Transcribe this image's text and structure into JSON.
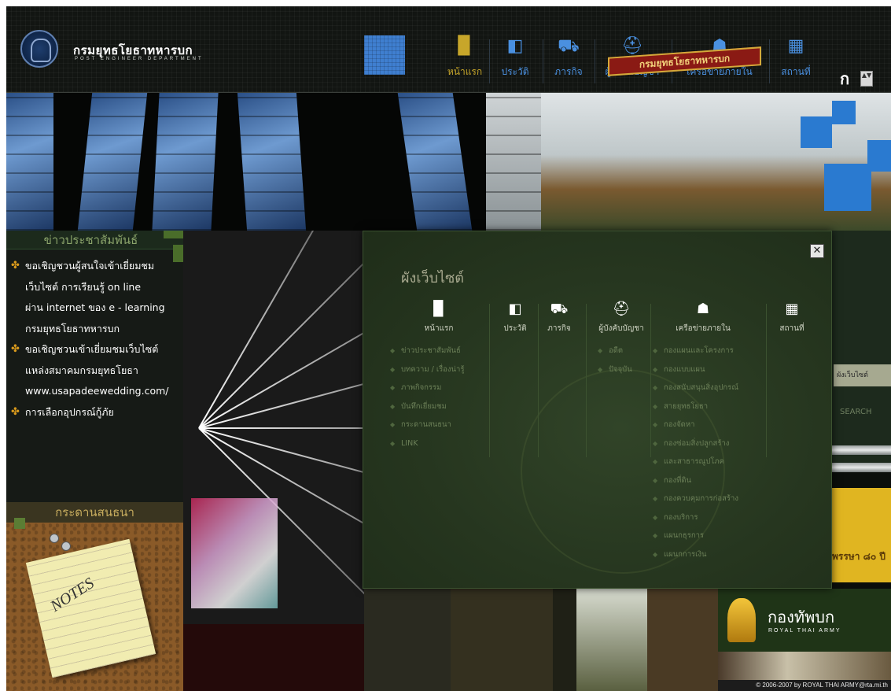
{
  "header": {
    "org_name": "กรมยุทธโยธาทหารบก",
    "org_sub": "POST ENGINEER DEPARTMENT",
    "nav": [
      {
        "label": "หน้าแรก",
        "icon": "book-icon",
        "glyph": "▉"
      },
      {
        "label": "ประวัติ",
        "icon": "open-book-icon",
        "glyph": "◧"
      },
      {
        "label": "ภารกิจ",
        "icon": "vehicle-icon",
        "glyph": "⛟"
      },
      {
        "label": "ผู้บังคับบัญชา",
        "icon": "cap-icon",
        "glyph": "⛑"
      },
      {
        "label": "เครือข่ายภายใน",
        "icon": "network-icon",
        "glyph": "☗"
      },
      {
        "label": "สถานที่",
        "icon": "building-icon",
        "glyph": "▦"
      }
    ],
    "font_size_letter": "ก",
    "font_size_arrows": "▲▼"
  },
  "banner": {
    "building_sign": "กรมยุทธโยธาทหารบก"
  },
  "news": {
    "title": "ข่าวประชาสัมพันธ์",
    "items": [
      {
        "lines": [
          "ขอเชิญชวนผู้สนใจเข้าเยี่ยมชม",
          "เว็บไซต์ การเรียนรู้ on line",
          "ผ่าน internet ของ e - learning",
          "กรมยุทธโยธาทหารบก"
        ]
      },
      {
        "lines": [
          "ขอเชิญชวนเข้าเยี่ยมชมเว็บไซต์",
          "แหล่งสมาคมกรมยุทธโยธา",
          "www.usapadeewedding.com/"
        ]
      },
      {
        "lines": [
          "การเลือกอุปกรณ์กู้ภัย"
        ]
      }
    ]
  },
  "board": {
    "title": "กระดานสนธนา",
    "note_text": "NOTES"
  },
  "right": {
    "search_placeholder": "ผังเว็บไซต์",
    "search_button": "SEARCH",
    "yellow_text": "พรรษา ๘๐ ปี"
  },
  "army": {
    "name": "กองทัพบก",
    "sub": "ROYAL THAI ARMY",
    "copyright": "© 2006-2007 by ROYAL THAI ARMY@rta.mi.th"
  },
  "sitemap": {
    "title": "ผังเว็บไซต์",
    "close": "✕",
    "columns": [
      {
        "label": "หน้าแรก",
        "icon": "book-icon",
        "glyph": "▉"
      },
      {
        "label": "ประวัติ",
        "icon": "open-book-icon",
        "glyph": "◧"
      },
      {
        "label": "ภารกิจ",
        "icon": "vehicle-icon",
        "glyph": "⛟"
      },
      {
        "label": "ผู้บังคับบัญชา",
        "icon": "cap-icon",
        "glyph": "⛑"
      },
      {
        "label": "เครือข่ายภายใน",
        "icon": "network-icon",
        "glyph": "☗"
      },
      {
        "label": "สถานที่",
        "icon": "building-icon",
        "glyph": "▦"
      }
    ],
    "home_links": [
      "ข่าวประชาสัมพันธ์",
      "บทความ / เรื่องน่ารู้",
      "ภาพกิจกรรม",
      "บันทึกเยี่ยมชม",
      "กระดานสนธนา",
      "LINK"
    ],
    "commander_links": [
      "อดีต",
      "ปัจจุบัน"
    ],
    "network_links": [
      "กองแผนและโครงการ",
      "กองแบบแผน",
      "กองสนับสนุนสิ่งอุปกรณ์",
      "สายยุทธโยธา",
      "กองจัดหา",
      "กองซ่อมสิ่งปลูกสร้าง",
      "และสาธารณูปโภค",
      "กองที่ดิน",
      "กองควบคุมการก่อสร้าง",
      "กองบริการ",
      "แผนกธุรการ",
      "แผนกการเงิน"
    ]
  }
}
